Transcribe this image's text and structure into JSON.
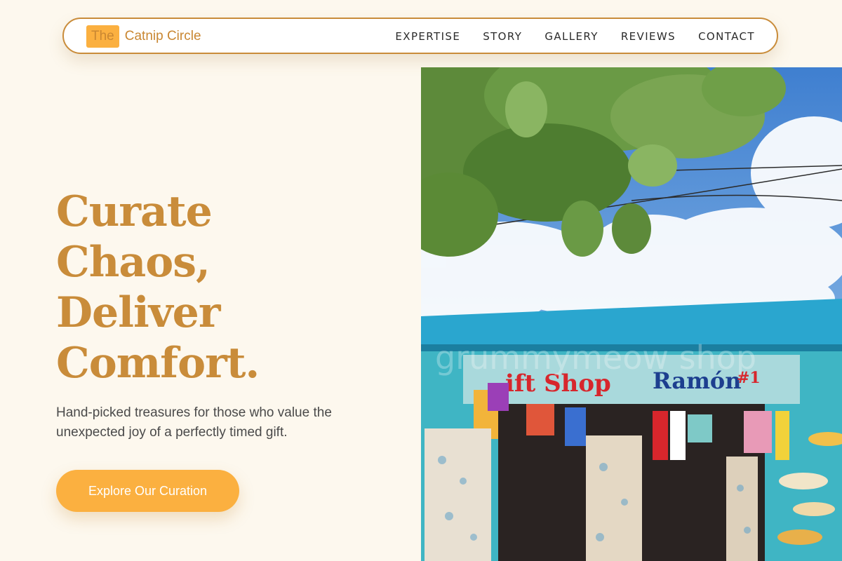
{
  "brand": {
    "badge": "The",
    "name": "Catnip Circle"
  },
  "nav": {
    "items": [
      "EXPERTISE",
      "STORY",
      "GALLERY",
      "REVIEWS",
      "CONTACT"
    ]
  },
  "hero": {
    "headline": [
      "Curate",
      "Chaos,",
      "Deliver",
      "Comfort."
    ],
    "subtitle": "Hand-picked treasures for those who value the unexpected joy of a perfectly timed gift.",
    "cta": "Explore Our Curation"
  },
  "photo": {
    "sign_left": "ift Shop",
    "sign_right": "Ramón",
    "sign_number": "#1",
    "watermark": "grummymeow shop"
  },
  "colors": {
    "accent": "#c98c3a",
    "cta": "#fbb040",
    "background": "#fdf8ee"
  }
}
